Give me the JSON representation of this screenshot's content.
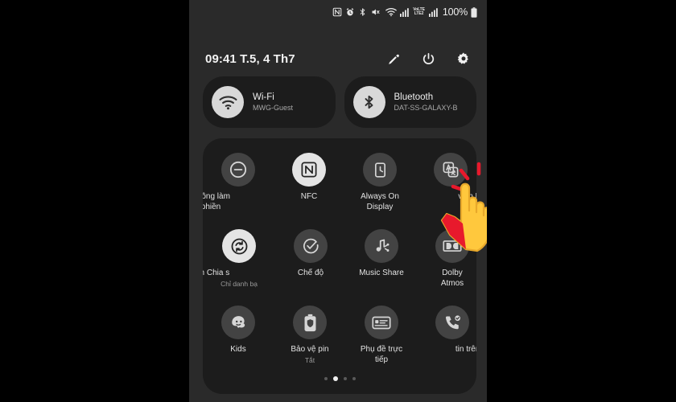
{
  "statusbar": {
    "icons": [
      "nfc-icon",
      "alarm-icon",
      "bluetooth-icon",
      "mute-icon",
      "wifi-icon",
      "signal-icon",
      "volte-icon",
      "signal2-icon"
    ],
    "volte_top": "VoLTE",
    "volte_bottom": "LTE2",
    "battery_percent": "100%"
  },
  "header": {
    "time": "09:41",
    "date": "T.5, 4 Th7",
    "clock_date": "09:41  T.5, 4 Th7",
    "edit_label": "edit-icon",
    "power_label": "power-icon",
    "settings_label": "settings-icon"
  },
  "pills": [
    {
      "icon": "wifi-icon",
      "title": "Wi-Fi",
      "subtitle": "MWG-Guest"
    },
    {
      "icon": "bluetooth-icon",
      "title": "Bluetooth",
      "subtitle": "DAT-SS-GALAXY-B"
    }
  ],
  "tiles": {
    "row0": [
      {
        "icon": "do-not-disturb-icon",
        "label": "Không làm\nphiền",
        "sub": "",
        "active": false
      },
      {
        "icon": "nfc-icon",
        "label": "NFC",
        "sub": "",
        "active": true
      },
      {
        "icon": "always-on-display-icon",
        "label": "Always On\nDisplay",
        "sub": "",
        "active": false
      },
      {
        "icon": "translate-icon",
        "label": "viền          Phiê",
        "sub": "",
        "active": false
      }
    ],
    "row1": [
      {
        "icon": "smart-view-share-icon",
        "label": "inh        Chia s",
        "sub": "Chỉ danh bạ",
        "active": true
      },
      {
        "icon": "driving-mode-icon",
        "label": "Chế độ",
        "sub": "",
        "active": false
      },
      {
        "icon": "music-share-icon",
        "label": "Music Share",
        "sub": "",
        "active": false
      },
      {
        "icon": "dolby-atmos-icon",
        "label": "Dolby\nAtmos",
        "sub": "",
        "active": false
      }
    ],
    "row2": [
      {
        "icon": "kids-mode-icon",
        "label": "Kids",
        "sub": "",
        "active": false
      },
      {
        "icon": "battery-protect-icon",
        "label": "Bảo vệ pin",
        "sub": "Tắt",
        "active": false
      },
      {
        "icon": "live-caption-icon",
        "label": "Phụ đề trực\ntiếp",
        "sub": "",
        "active": false
      },
      {
        "icon": "call-on-device-icon",
        "label": "tin trên thiết",
        "sub": "",
        "active": false
      }
    ]
  },
  "page_dots": {
    "count": 4,
    "active_index": 1
  },
  "cursor": {
    "name": "hand-pointer-cursor",
    "color": "#FFC83D",
    "sleeve_color": "#E8192C",
    "burst_color": "#E8192C"
  },
  "colors": {
    "screen_background": "#2a2a2a",
    "panel_background": "#1c1c1c",
    "tile_off": "#434343",
    "tile_on": "#e4e4e4",
    "text_primary": "#f0f0f0",
    "text_secondary": "#9a9a9a",
    "letterbox": "#000000"
  }
}
